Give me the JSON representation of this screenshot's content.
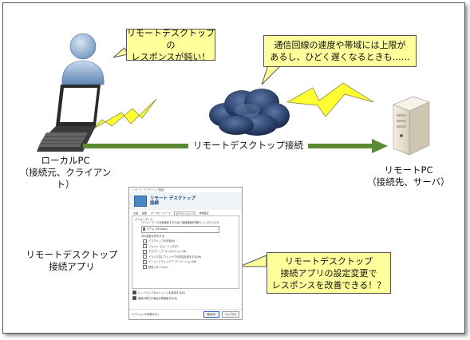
{
  "callouts": {
    "local": [
      "リモートデスクトップの",
      "レスポンスが鈍い！"
    ],
    "network": [
      "通信回線の速度や帯域には上限が",
      "あるし、ひどく遅くなるときも……"
    ],
    "app": [
      "リモートデスクトップ",
      "接続アプリの設定変更で",
      "レスポンスを改善できる！？"
    ]
  },
  "labels": {
    "local_pc": [
      "ローカルPC",
      "（接続元、クライアント）"
    ],
    "remote_pc": [
      "リモートPC",
      "（接続先、サーバ）"
    ],
    "connection": "リモートデスクトップ接続",
    "app": [
      "リモートデスクトップ",
      "接続アプリ"
    ]
  },
  "dialog": {
    "window_title": "リモート デスクトップ接続",
    "header": [
      "リモート デスクトップ",
      "接続"
    ],
    "tabs": [
      "全般",
      "画面",
      "ローカル リソース",
      "エクスペリエンス",
      "詳細設定"
    ],
    "active_tab": 3,
    "group_title": "パフォーマンス",
    "prompt": "パフォーマンスを最適化するために接続速度を選択してください(O):",
    "speed_value": "モデム (56 Kbps)",
    "allow_label": "次の設定を許可する:",
    "options": [
      {
        "label": "デスクトップの背景(K)",
        "checked": false
      },
      {
        "label": "フォント スムージング(F)",
        "checked": false
      },
      {
        "label": "デスクトップ コンポジション(D)",
        "checked": false
      },
      {
        "label": "ドラッグ中にウィンドウの内容を表示する(W)",
        "checked": false
      },
      {
        "label": "メニューとウィンドウ アニメーション(M)",
        "checked": false
      },
      {
        "label": "視覚スタイル(V)",
        "checked": false
      }
    ],
    "bottom_options": [
      {
        "label": "ビットマップのキャッシュを保持する(B)",
        "checked": true
      },
      {
        "label": "接続が落ちた場合は再接続する(R)",
        "checked": true
      }
    ],
    "hide_options": "オプションの非表示(O)",
    "connect": "接続(N)",
    "help": "ヘルプ(H)"
  },
  "colors": {
    "callout": "#ffff9c",
    "bolt": "#ffff33",
    "link_arrow": "#5c8a32",
    "cloud": "#233a63"
  }
}
